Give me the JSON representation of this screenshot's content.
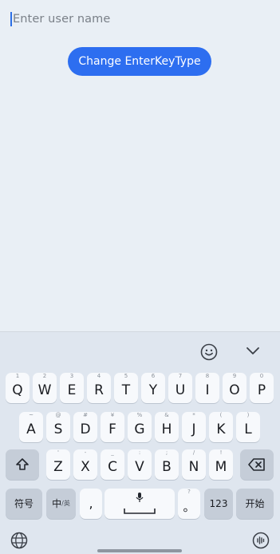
{
  "input": {
    "placeholder": "Enter user name"
  },
  "button": {
    "label": "Change EnterKeyType"
  },
  "keyboard": {
    "row1": [
      {
        "key": "Q",
        "hint": "1"
      },
      {
        "key": "W",
        "hint": "2"
      },
      {
        "key": "E",
        "hint": "3"
      },
      {
        "key": "R",
        "hint": "4"
      },
      {
        "key": "T",
        "hint": "5"
      },
      {
        "key": "Y",
        "hint": "6"
      },
      {
        "key": "U",
        "hint": "7"
      },
      {
        "key": "I",
        "hint": "8"
      },
      {
        "key": "O",
        "hint": "9"
      },
      {
        "key": "P",
        "hint": "0"
      }
    ],
    "row2": [
      {
        "key": "A",
        "hint": "~"
      },
      {
        "key": "S",
        "hint": "@"
      },
      {
        "key": "D",
        "hint": "#"
      },
      {
        "key": "F",
        "hint": "¥"
      },
      {
        "key": "G",
        "hint": "%"
      },
      {
        "key": "H",
        "hint": "&"
      },
      {
        "key": "J",
        "hint": "*"
      },
      {
        "key": "K",
        "hint": "("
      },
      {
        "key": "L",
        "hint": ")"
      }
    ],
    "row3": [
      {
        "key": "Z",
        "hint": "'"
      },
      {
        "key": "X",
        "hint": "-"
      },
      {
        "key": "C",
        "hint": "_"
      },
      {
        "key": "V",
        "hint": ":"
      },
      {
        "key": "B",
        "hint": ";"
      },
      {
        "key": "N",
        "hint": "/"
      },
      {
        "key": "M",
        "hint": "!"
      }
    ],
    "symbols_label": "符号",
    "lang_toggle": {
      "primary": "中",
      "secondary": "/英"
    },
    "comma": ",",
    "period": "。",
    "period_hint": "?",
    "numbers_label": "123",
    "enter_label": "开始"
  }
}
